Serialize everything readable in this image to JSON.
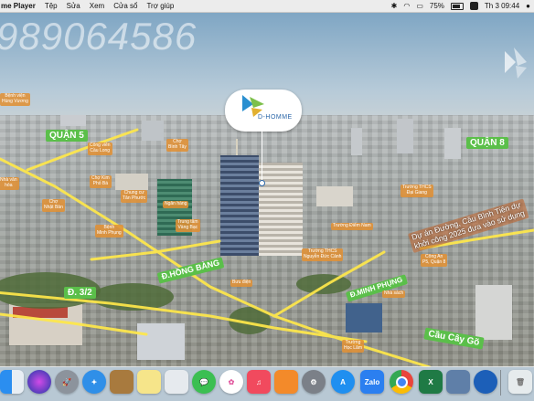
{
  "menubar": {
    "app_name": "me Player",
    "menus": [
      "Tệp",
      "Sửa",
      "Xem",
      "Cửa sổ",
      "Trợ giúp"
    ],
    "battery_percent": "75%",
    "clock": "Th 3 09:44"
  },
  "watermark_phone": "989064586",
  "project": {
    "logo_text": "D-HOMME"
  },
  "district_labels": {
    "quan5": "QUẬN 5",
    "quan8": "QUẬN 8"
  },
  "road_labels": {
    "hong_bang": "Đ.HỒNG BÀNG",
    "d32": "Đ. 3/2",
    "minh_phung": "Đ.MINH PHỤNG",
    "cau_cay_go": "Cầu Cây Gõ"
  },
  "poi_labels": {
    "benh_vien_hung_vuong": "Bệnh viện\nHùng Vương",
    "cho_binh_tay": "Chợ\nBình Tây",
    "cong_vien_cau_long": "Công viên\nCầu Long",
    "nha_van_hoa": "Nhà văn\nhóa",
    "cho_nhat_ban": "Chợ\nNhật Bản",
    "cho_kim_bien": "Chợ Kim\nPhố Bá",
    "chung_cu_tan_phuoc": "Chung cư\nTân Phước",
    "ngan_hang": "Ngân hàng",
    "benh_vien_minh_phung": "Bệnh\nMinh Phụng",
    "trung_tam_vang_bac": "Trung tâm\nVàng Bạc",
    "truong_thcs_dai_giang": "Trường THCS\nĐại Giang",
    "truong_diem_nam": "Trường Điểm Nam",
    "truong_nguyen_duc_canh": "Trường THCS\nNguyễn Đức Cảnh",
    "cong_an_quan": "Công An\nP5, Quận 8",
    "buu_dien": "Bưu điện",
    "nha_sach": "Nhà sách",
    "truong_hoc_lam": "Trường\nHọc Lâm"
  },
  "project_note": {
    "line1": "Dự án Đường, Cầu Bình Tiên dự",
    "line2": "khởi công 2025 đưa vào sử dụng"
  },
  "dock": {
    "apps": [
      "finder-icon",
      "siri-icon",
      "launchpad-icon",
      "safari-icon",
      "notes-icon",
      "stickies-icon",
      "preview-icon",
      "messages-icon",
      "photos-icon",
      "music-icon",
      "books-icon",
      "settings-icon",
      "appstore-icon",
      "zalo-icon",
      "chrome-icon",
      "excel-icon",
      "screen-icon",
      "browser-icon",
      "trash-icon"
    ],
    "zalo_label": "Zalo"
  }
}
